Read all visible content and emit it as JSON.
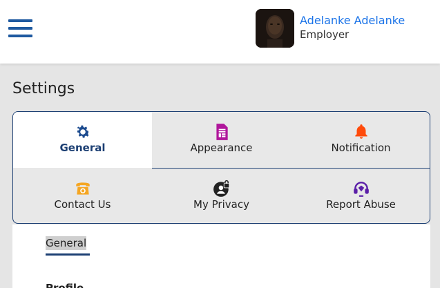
{
  "header": {
    "menu_icon": "hamburger-menu-icon",
    "user": {
      "name": "Adelanke Adelanke",
      "role": "Employer"
    }
  },
  "page": {
    "title": "Settings"
  },
  "tabs": [
    {
      "label": "General",
      "icon": "gear-icon",
      "color": "#1c4b8f",
      "active": true
    },
    {
      "label": "Appearance",
      "icon": "document-icon",
      "color": "#b0169b",
      "active": false
    },
    {
      "label": "Notification",
      "icon": "bell-icon",
      "color": "#ff4a0a",
      "active": false
    },
    {
      "label": "Contact Us",
      "icon": "telephone-icon",
      "color": "#f5a623",
      "active": false
    },
    {
      "label": "My Privacy",
      "icon": "user-lock-icon",
      "color": "#222222",
      "active": false
    },
    {
      "label": "Report Abuse",
      "icon": "headset-icon",
      "color": "#5b1fa8",
      "active": false
    }
  ],
  "content": {
    "sub_tab": "General",
    "section_label": "Profile"
  },
  "colors": {
    "accent": "#1c3f73",
    "link": "#1a73e8"
  }
}
